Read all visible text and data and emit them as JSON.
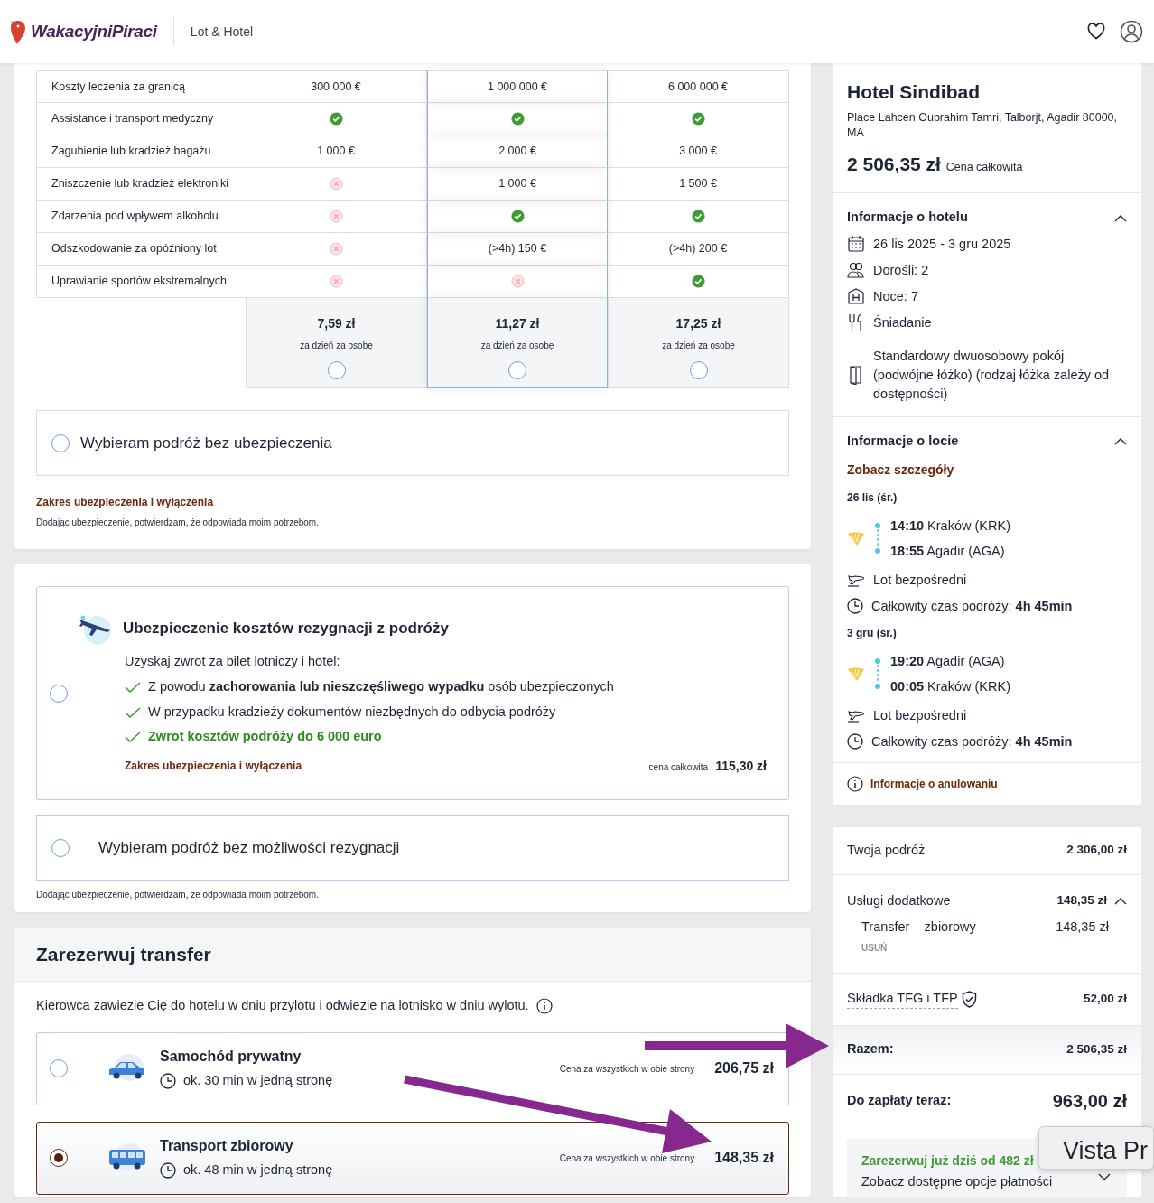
{
  "header": {
    "logo": "WakacyjniPiraci",
    "section": "Lot & Hotel"
  },
  "insurance": {
    "rows": [
      {
        "label": "Koszty leczenia za granicą",
        "cells": [
          {
            "kind": "text",
            "text": "300 000 €"
          },
          {
            "kind": "text",
            "text": "1 000 000 €"
          },
          {
            "kind": "text",
            "text": "6 000 000 €"
          }
        ]
      },
      {
        "label": "Assistance i transport medyczny",
        "cells": [
          {
            "kind": "yes"
          },
          {
            "kind": "yes"
          },
          {
            "kind": "yes"
          }
        ]
      },
      {
        "label": "Zagubienie lub kradzież bagażu",
        "cells": [
          {
            "kind": "text",
            "text": "1 000 €"
          },
          {
            "kind": "text",
            "text": "2 000 €"
          },
          {
            "kind": "text",
            "text": "3 000 €"
          }
        ]
      },
      {
        "label": "Zniszczenie lub kradzież elektroniki",
        "cells": [
          {
            "kind": "no"
          },
          {
            "kind": "text",
            "text": "1 000 €"
          },
          {
            "kind": "text",
            "text": "1 500 €"
          }
        ]
      },
      {
        "label": "Zdarzenia pod wpływem alkoholu",
        "cells": [
          {
            "kind": "no"
          },
          {
            "kind": "yes"
          },
          {
            "kind": "yes"
          }
        ]
      },
      {
        "label": "Odszkodowanie za opóźniony lot",
        "cells": [
          {
            "kind": "no"
          },
          {
            "kind": "text",
            "text": "(>4h) 150 €"
          },
          {
            "kind": "text",
            "text": "(>4h) 200 €"
          }
        ]
      },
      {
        "label": "Uprawianie sportów ekstremalnych",
        "cells": [
          {
            "kind": "no"
          },
          {
            "kind": "no"
          },
          {
            "kind": "yes"
          }
        ]
      }
    ],
    "plans": [
      {
        "price": "7,59 zł",
        "note": "za dzień za osobę",
        "highlighted": false,
        "selected": false
      },
      {
        "price": "11,27 zł",
        "note": "za dzień za osobę",
        "highlighted": true,
        "selected": false
      },
      {
        "price": "17,25 zł",
        "note": "za dzień za osobę",
        "highlighted": false,
        "selected": false
      }
    ],
    "no_insurance": {
      "label": "Wybieram podróż bez ubezpieczenia",
      "selected": false
    },
    "scope_link": "Zakres ubezpieczenia i wyłączenia",
    "disclaimer": "Dodając ubezpieczenie, potwierdzam, że odpowiada moim potrzebom."
  },
  "cancellation": {
    "title": "Ubezpieczenie kosztów rezygnacji z podróży",
    "subtitle": "Uzyskaj zwrot za bilet lotniczy i hotel:",
    "features": [
      {
        "kind": "plain",
        "text": "Z powodu **zachorowania lub nieszczęśliwego wypadku** osób ubezpieczonych"
      },
      {
        "kind": "plain",
        "text": "W przypadku kradzieży dokumentów niezbędnych do odbycia podróży"
      },
      {
        "kind": "highlight",
        "text": "Zwrot kosztów podróży do 6 000 euro"
      }
    ],
    "scope_link": "Zakres ubezpieczenia i wyłączenia",
    "price_label": "cena całkowita",
    "price": "115,30 zł",
    "selected": false,
    "no_cancellation": {
      "label": "Wybieram podróż bez możliwości rezygnacji",
      "selected": false
    },
    "disclaimer": "Dodając ubezpieczenie, potwierdzam, że odpowiada moim potrzebom."
  },
  "transfer": {
    "title": "Zarezerwuj transfer",
    "description": "Kierowca zawiezie Cię do hotelu w dniu przylotu i odwiezie na lotnisko w dniu wylotu.",
    "options": [
      {
        "kind": "car",
        "name": "Samochód prywatny",
        "duration": "ok. 30 min w jedną stronę",
        "price_label": "Cena za wszystkich w obie strony",
        "price": "206,75 zł",
        "selected": false
      },
      {
        "kind": "bus",
        "name": "Transport zbiorowy",
        "duration": "ok. 48 min w jedną stronę",
        "price_label": "Cena za wszystkich w obie strony",
        "price": "148,35 zł",
        "selected": true
      }
    ]
  },
  "hotel": {
    "name": "Hotel Sindibad",
    "address": "Place Lahcen Oubrahim Tamri, Talborjt, Agadir 80000, MA",
    "price": "2 506,35 zł",
    "price_label": "Cena całkowita"
  },
  "hotel_info": {
    "title": "Informacje o hotelu",
    "expanded": true,
    "items": [
      {
        "kind": "calendar",
        "text": "26 lis 2025 - 3 gru 2025"
      },
      {
        "kind": "people",
        "text": "Dorośli: 2"
      },
      {
        "kind": "nights",
        "text": "Noce: 7"
      },
      {
        "kind": "meal",
        "text": "Śniadanie"
      },
      {
        "kind": "room",
        "text": "Standardowy dwuosobowy pokój (podwójne łóżko) (rodzaj łóżka zależy od dostępności)"
      }
    ]
  },
  "flight_info": {
    "title": "Informacje o locie",
    "expanded": true,
    "details_link": "Zobacz szczegóły",
    "legs": [
      {
        "date": "26 lis (śr.)",
        "stops": [
          {
            "time": "14:10",
            "place": "Kraków (KRK)"
          },
          {
            "time": "18:55",
            "place": "Agadir (AGA)"
          }
        ],
        "direct": "Lot bezpośredni",
        "duration": "Całkowity czas podróży: **4h 45min**"
      },
      {
        "date": "3 gru (śr.)",
        "stops": [
          {
            "time": "19:20",
            "place": "Agadir (AGA)"
          },
          {
            "time": "00:05",
            "place": "Kraków (KRK)"
          }
        ],
        "direct": "Lot bezpośredni",
        "duration": "Całkowity czas podróży: **4h 45min**"
      }
    ]
  },
  "cancel_info": "Informacje o anulowaniu",
  "summary": {
    "trip": {
      "label": "Twoja podróż",
      "value": "2 306,00 zł"
    },
    "extras": {
      "label": "Usługi dodatkowe",
      "value": "148,35 zł",
      "expanded": true,
      "items": [
        {
          "label": "Transfer – zbiorowy",
          "value": "148,35 zł",
          "remove": "USUŃ"
        }
      ]
    },
    "fee": {
      "label": "Składka TFG i TFP",
      "value": "52,00 zł"
    },
    "total": {
      "label": "Razem:",
      "value": "2 506,35 zł"
    },
    "pay_now": {
      "label": "Do zapłaty teraz:",
      "value": "963,00 zł"
    },
    "payment_offer": {
      "title": "Zarezerwuj już dziś od 482 zł",
      "subtitle": "Zobacz dostępne opcje płatności",
      "expanded": false
    }
  },
  "tooltip": "Vista Pr"
}
